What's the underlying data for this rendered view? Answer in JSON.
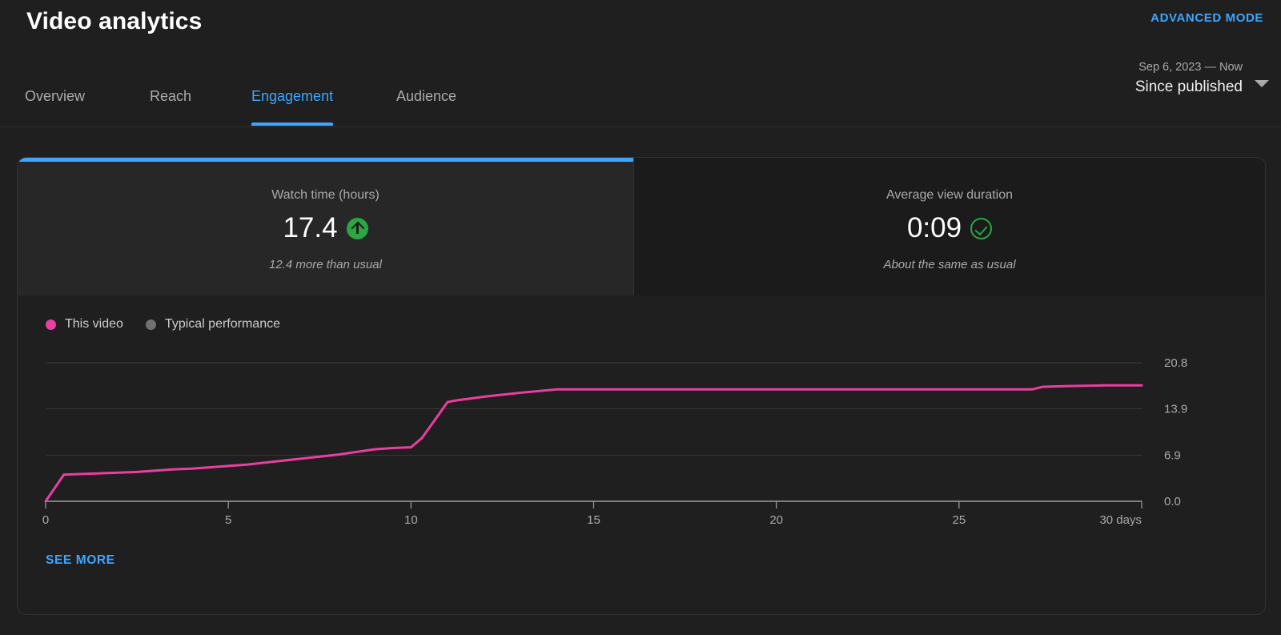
{
  "header": {
    "title": "Video analytics",
    "advanced_mode": "ADVANCED MODE",
    "accent_blue": "#3ea6ff"
  },
  "date_range": {
    "range_text": "Sep 6, 2023 — Now",
    "selected_label": "Since published",
    "caret_icon": "chevron-down-icon"
  },
  "tabs": [
    {
      "label": "Overview",
      "active": false
    },
    {
      "label": "Reach",
      "active": false
    },
    {
      "label": "Engagement",
      "active": true
    },
    {
      "label": "Audience",
      "active": false
    }
  ],
  "metrics": [
    {
      "label": "Watch time (hours)",
      "value": "17.4",
      "comparison": "12.4 more than usual",
      "status_icon": "arrow-up-circle-icon",
      "status_color": "#2ba640",
      "selected": true
    },
    {
      "label": "Average view duration",
      "value": "0:09",
      "comparison": "About the same as usual",
      "status_icon": "check-circle-icon",
      "status_color": "#2ba640",
      "selected": false
    }
  ],
  "legend": [
    {
      "label": "This video",
      "color": "#eb3ea0"
    },
    {
      "label": "Typical performance",
      "color": "#717171"
    }
  ],
  "see_more_label": "SEE MORE",
  "chart_data": {
    "type": "line",
    "title": "Watch time (hours)",
    "xlabel": "days",
    "ylabel": "Watch time (hours)",
    "x_tick_labels": [
      "0",
      "5",
      "10",
      "15",
      "20",
      "25",
      "30 days"
    ],
    "x_ticks": [
      0,
      5,
      10,
      15,
      20,
      25,
      30
    ],
    "y_tick_labels": [
      "0.0",
      "6.9",
      "13.9",
      "20.8"
    ],
    "y_ticks": [
      0.0,
      6.9,
      13.9,
      20.8
    ],
    "xlim": [
      0,
      30
    ],
    "ylim": [
      0,
      20.8
    ],
    "grid": true,
    "legend_position": "top-left",
    "series": [
      {
        "name": "This video",
        "color": "#eb3ea0",
        "x": [
          0,
          0.5,
          1,
          1.5,
          2,
          2.5,
          3,
          3.5,
          4,
          4.5,
          5,
          5.5,
          6,
          6.5,
          7,
          7.5,
          8,
          8.5,
          9,
          9.5,
          10,
          10.3,
          10.6,
          11,
          11.3,
          11.6,
          12,
          12.5,
          13,
          14,
          16,
          18,
          20,
          22,
          24,
          26,
          27,
          27.3,
          28,
          29,
          30
        ],
        "values": [
          0,
          4.0,
          4.1,
          4.2,
          4.3,
          4.4,
          4.6,
          4.8,
          4.9,
          5.1,
          5.3,
          5.5,
          5.8,
          6.1,
          6.4,
          6.7,
          7.0,
          7.4,
          7.8,
          8.0,
          8.1,
          9.5,
          11.8,
          14.9,
          15.2,
          15.4,
          15.7,
          16.0,
          16.3,
          16.8,
          16.8,
          16.8,
          16.8,
          16.8,
          16.8,
          16.8,
          16.8,
          17.2,
          17.3,
          17.4,
          17.4
        ]
      },
      {
        "name": "Typical performance",
        "color": "#717171",
        "x": [],
        "values": []
      }
    ]
  }
}
